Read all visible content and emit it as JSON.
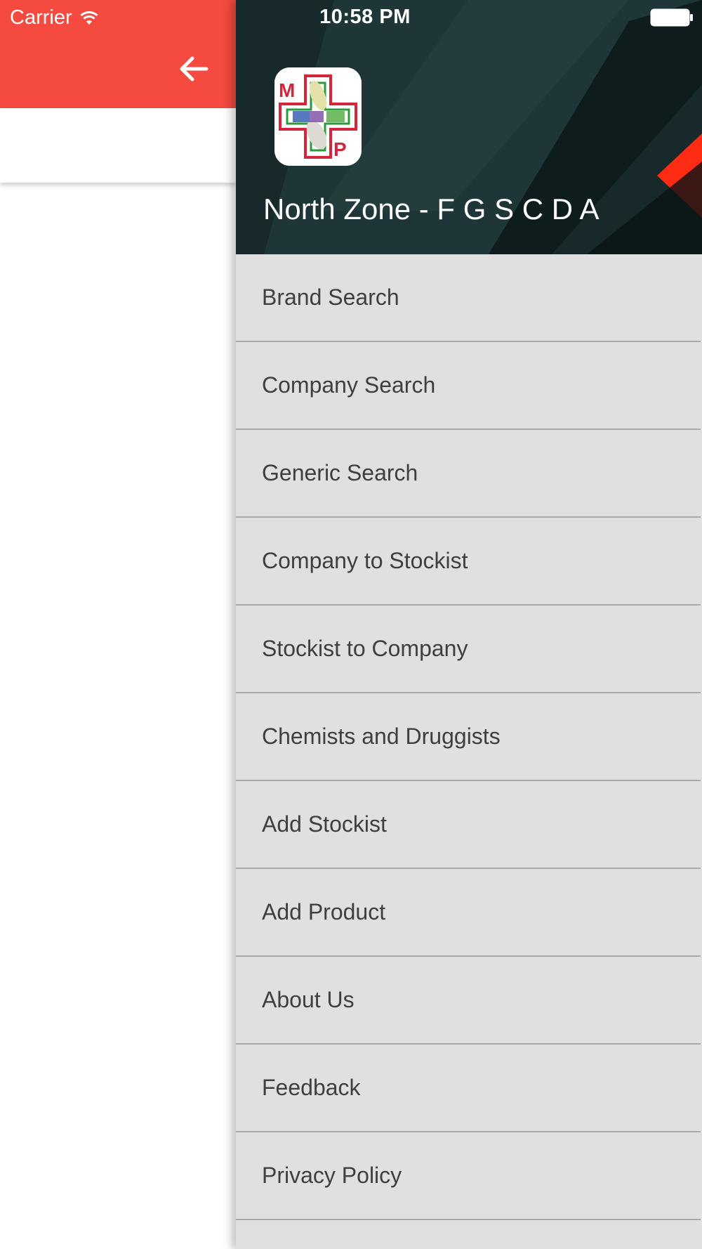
{
  "status_bar": {
    "carrier": "Carrier",
    "time": "10:58 PM"
  },
  "left_page": {
    "appbar_color": "#f44a3f",
    "back_icon": "arrow-left-icon"
  },
  "drawer": {
    "title": "North Zone - F G S C D A",
    "logo_text": {
      "m": "M",
      "p": "P"
    },
    "menu_items": [
      {
        "label": "Brand Search"
      },
      {
        "label": "Company Search"
      },
      {
        "label": "Generic Search"
      },
      {
        "label": "Company to Stockist"
      },
      {
        "label": "Stockist to Company"
      },
      {
        "label": "Chemists and Druggists"
      },
      {
        "label": "Add Stockist"
      },
      {
        "label": "Add Product"
      },
      {
        "label": "About Us"
      },
      {
        "label": "Feedback"
      },
      {
        "label": "Privacy Policy"
      },
      {
        "label": ""
      }
    ]
  },
  "colors": {
    "header_dark": "#17292a",
    "accent_red": "#f44a3f",
    "drawer_background": "#e0e0e0",
    "divider": "#a9a9a9",
    "menu_text": "#3f3f3f"
  }
}
